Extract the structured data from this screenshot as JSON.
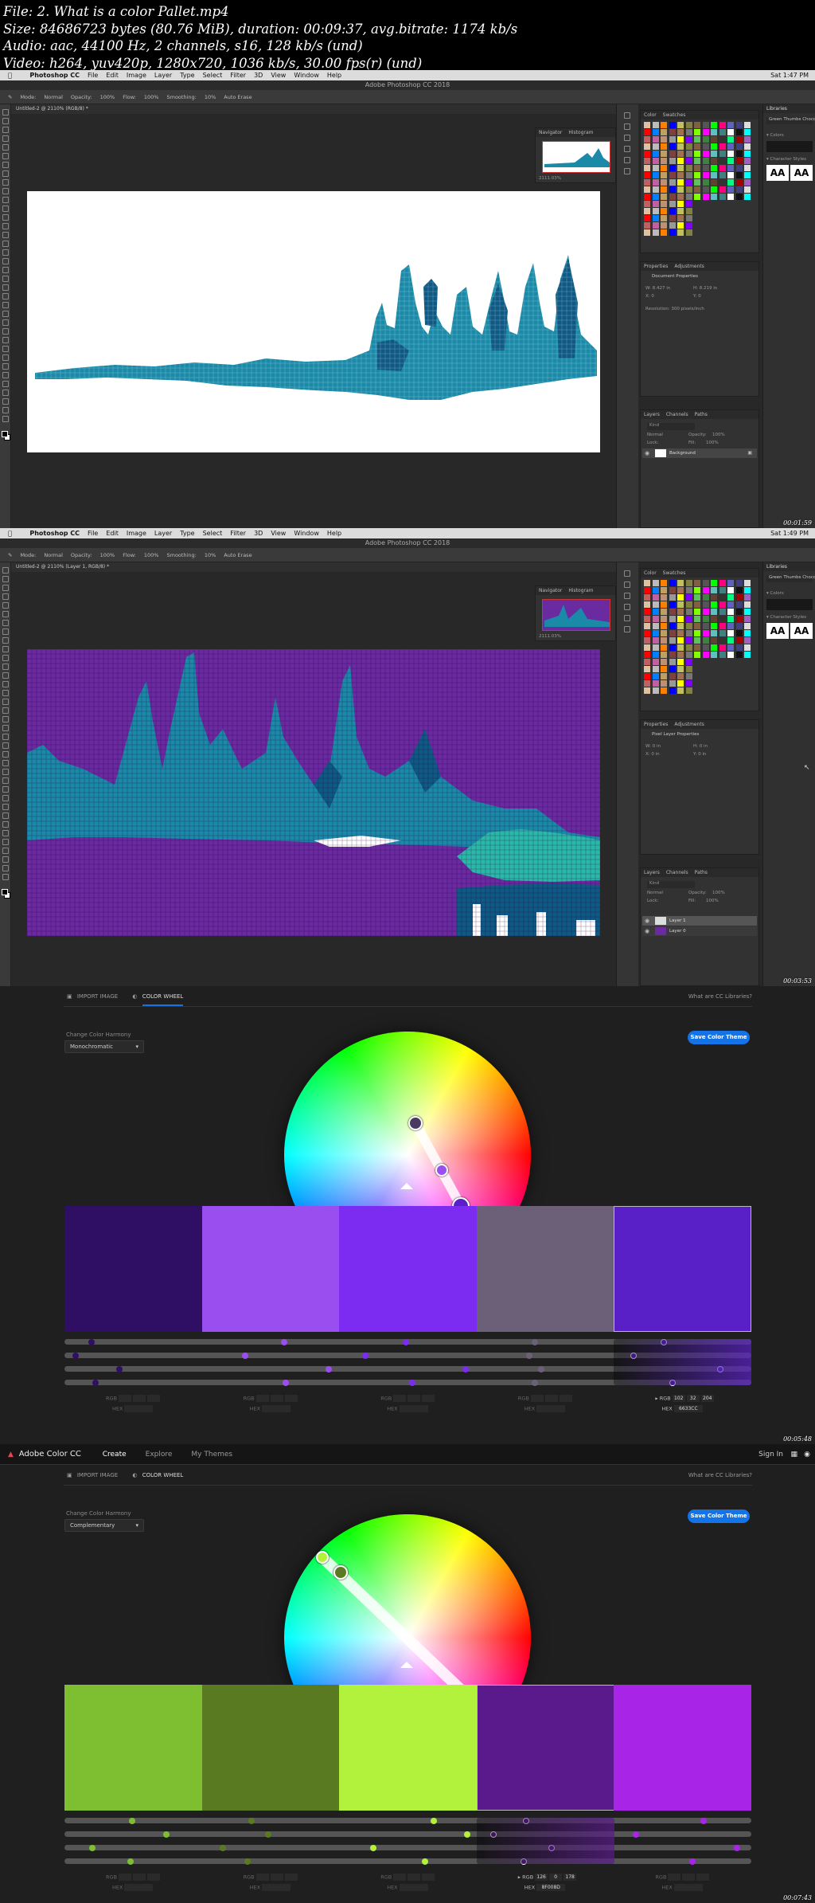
{
  "info": {
    "file_line": "File: 2. What is a color Pallet.mp4",
    "size_line": "Size: 84686723 bytes (80.76 MiB), duration: 00:09:37, avg.bitrate: 1174 kb/s",
    "audio_line": "Audio: aac, 44100 Hz, 2 channels, s16, 128 kb/s (und)",
    "video_line": "Video: h264, yuv420p, 1280x720, 1036 kb/s, 30.00 fps(r) (und)"
  },
  "ps": {
    "menu": [
      "Photoshop CC",
      "File",
      "Edit",
      "Image",
      "Layer",
      "Type",
      "Select",
      "Filter",
      "3D",
      "View",
      "Window",
      "Help"
    ],
    "app_title": "Adobe Photoshop CC 2018",
    "options": [
      "Mode:",
      "Normal",
      "Opacity:",
      "100%",
      "Flow:",
      "100%",
      "Smoothing:",
      "10%",
      "Auto Erase"
    ],
    "panel_tabs_nav": [
      "Navigator",
      "Histogram"
    ],
    "panel_tabs_color": [
      "Color",
      "Swatches"
    ],
    "panel_tabs_props": [
      "Properties",
      "Adjustments"
    ],
    "panel_tabs_layers": [
      "Layers",
      "Channels",
      "Paths"
    ],
    "libraries": "Libraries",
    "library_name": "Green Thumbs Chocol...",
    "colors_label": "▾ Colors",
    "char_styles_label": "▾ Character Styles",
    "char_sample": "AA",
    "layer_kind": "Kind",
    "blend_mode": "Normal",
    "opacity_label": "Opacity:",
    "opacity_value": "100%",
    "lock_label": "Lock:",
    "fill_label": "Fill:",
    "fill_value": "100%",
    "frame1": {
      "clock": "Sat 1:47 PM",
      "doc_tab": "Untitled-2 @ 2110% (RGB/8) *",
      "nav_zoom": "2111.03%",
      "props_title": "Document Properties",
      "props_w": "W: 8.427 in",
      "props_h": "H: 8.219 in",
      "props_x": "X: 0",
      "props_y": "Y: 0",
      "props_res": "Resolution: 300 pixels/inch",
      "layers": [
        "Background"
      ],
      "timestamp": "00:01:59"
    },
    "frame2": {
      "clock": "Sat 1:49 PM",
      "doc_tab": "Untitled-2 @ 2110% (Layer 1, RGB/8) *",
      "nav_zoom": "2111.03%",
      "props_title": "Pixel Layer Properties",
      "props_w": "W: 0 in",
      "props_h": "H: 0 in",
      "props_x": "X: 0 in",
      "props_y": "Y: 0 in",
      "layers": [
        "Layer 1",
        "Layer 0"
      ],
      "timestamp": "00:03:53"
    }
  },
  "ac": {
    "brand": "Adobe Color CC",
    "nav": [
      "Create",
      "Explore",
      "My Themes"
    ],
    "sign_in": "Sign In",
    "import_tab": "IMPORT IMAGE",
    "wheel_tab": "COLOR WHEEL",
    "cc_libraries": "What are CC Libraries?",
    "harmony_label": "Change Color Harmony",
    "save_btn": "Save Color Theme",
    "rgb_label": "RGB",
    "hex_label": "HEX",
    "frame3": {
      "harmony": "Monochromatic",
      "colors": [
        "#2f0f64",
        "#9a4ef0",
        "#7b2cf0",
        "#6b6078",
        "#5a20c8"
      ],
      "selected": 4,
      "rgb_values": [
        "102",
        "32",
        "204"
      ],
      "hex_value": "6633CC",
      "timestamp": "00:05:48"
    },
    "frame4": {
      "harmony": "Complementary",
      "colors": [
        "#7dbf30",
        "#5a7a22",
        "#b2f23c",
        "#5a1a8c",
        "#a825e8"
      ],
      "selected": 3,
      "rgb_values": [
        "126",
        "0",
        "178"
      ],
      "hex_value": "8F008D",
      "timestamp": "00:07:43"
    }
  }
}
